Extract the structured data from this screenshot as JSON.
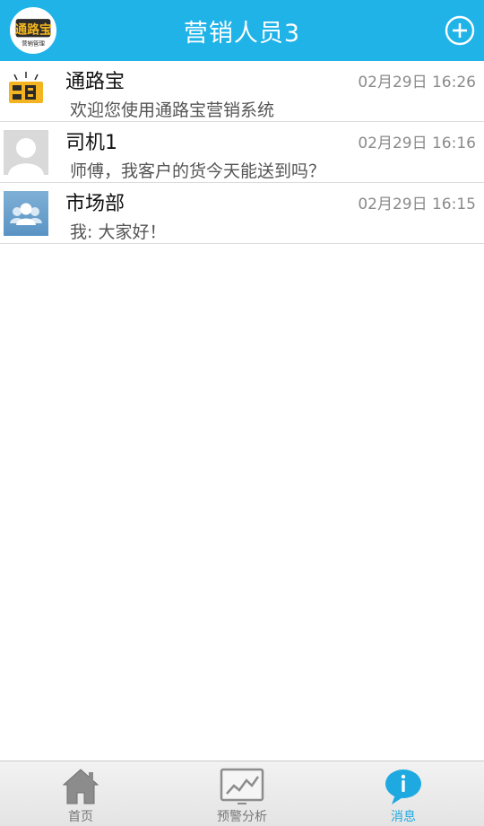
{
  "header": {
    "title": "营销人员3",
    "logo_text": "通路宝",
    "logo_caption": "营销管理",
    "add_icon": "plus-circle-icon"
  },
  "conversations": [
    {
      "name": "通路宝",
      "time": "02月29日 16:26",
      "preview": "欢迎您使用通路宝营销系统",
      "avatar": "app-logo-avatar"
    },
    {
      "name": "司机1",
      "time": "02月29日 16:16",
      "preview": "师傅，我客户的货今天能送到吗？",
      "avatar": "default-user-avatar"
    },
    {
      "name": "市场部",
      "time": "02月29日 16:15",
      "preview": "我: 大家好！",
      "avatar": "group-avatar"
    }
  ],
  "bottom_nav": {
    "items": [
      {
        "label": "首页",
        "icon": "home-icon",
        "active": false
      },
      {
        "label": "预警分析",
        "icon": "chart-icon",
        "active": false
      },
      {
        "label": "消息",
        "icon": "message-icon",
        "active": true
      }
    ]
  },
  "colors": {
    "header_bg": "#1fb3e8",
    "active_tab": "#1fa9e1"
  }
}
